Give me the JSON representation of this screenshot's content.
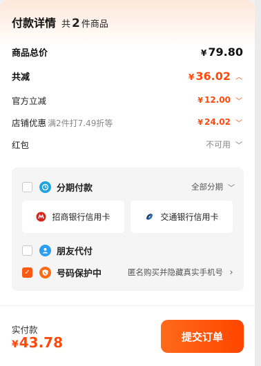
{
  "header": {
    "title": "付款详情",
    "count_prefix": "共",
    "count": "2",
    "count_suffix": "件商品"
  },
  "summary": {
    "total": {
      "label": "商品总价",
      "currency": "¥",
      "value": "79.80"
    },
    "discount": {
      "label": "共减",
      "currency": "¥",
      "value": "36.02"
    },
    "official": {
      "label": "官方立减",
      "currency": "¥",
      "value": "12.00"
    },
    "store": {
      "label": "店铺优惠",
      "note": "满2件打7.49折等",
      "currency": "¥",
      "value": "24.02"
    },
    "redpacket": {
      "label": "红包",
      "status": "不可用"
    }
  },
  "payment": {
    "installment": {
      "label": "分期付款",
      "right": "全部分期",
      "checked": false
    },
    "banks": [
      {
        "name": "招商银行信用卡",
        "icon": "cmb-bank-icon"
      },
      {
        "name": "交通银行信用卡",
        "icon": "bocom-bank-icon"
      }
    ],
    "friend_pay": {
      "label": "朋友代付",
      "checked": false
    },
    "number_protect": {
      "label": "号码保护中",
      "right": "匿名购买并隐藏真实手机号",
      "checked": true
    }
  },
  "footer": {
    "paid_label": "实付款",
    "currency": "¥",
    "paid_amount": "43.78",
    "submit_label": "提交订单"
  },
  "colors": {
    "accent": "#ff4a0b",
    "installment_icon": "#1fa3e0",
    "friend_icon": "#2a9df4",
    "shield_icon": "#ff6a14"
  }
}
